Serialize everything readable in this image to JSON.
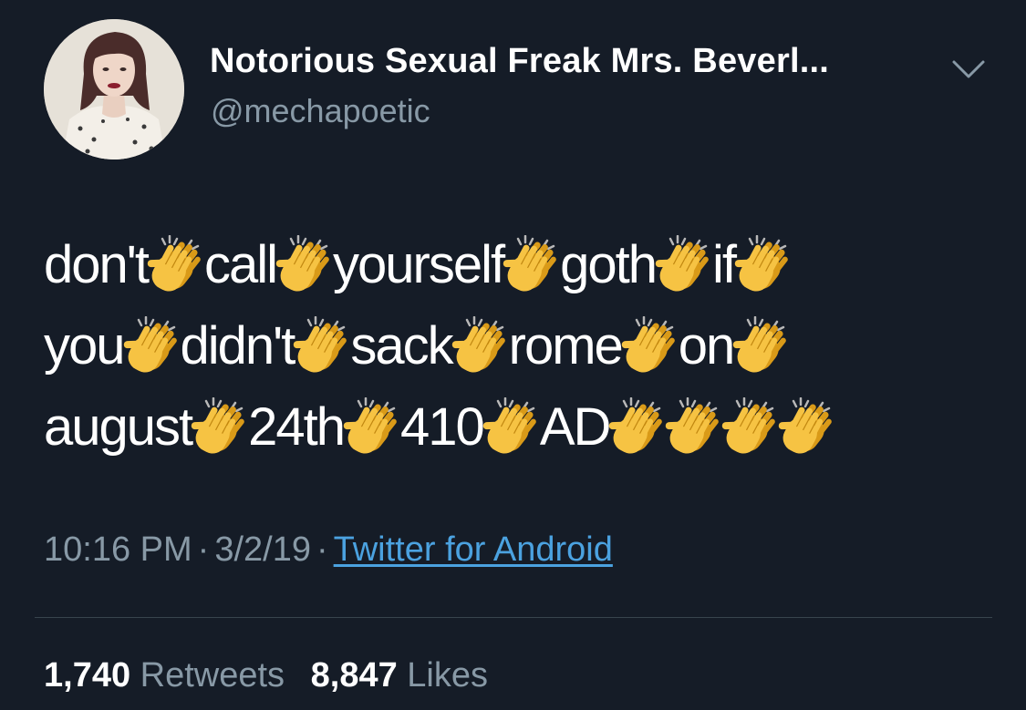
{
  "tweet": {
    "user": {
      "display_name": "Notorious Sexual Freak Mrs. Beverl...",
      "handle": "@mechapoetic",
      "avatar_icon": "profile-photo",
      "menu_icon": "chevron-down-icon"
    },
    "lines": [
      [
        "don't",
        "clap",
        "call",
        "clap",
        "yourself",
        "clap",
        "goth",
        "clap",
        "if",
        "clap"
      ],
      [
        "you",
        "clap",
        "didn't",
        "clap",
        "sack",
        "clap",
        "rome",
        "clap",
        "on",
        "clap"
      ],
      [
        "august",
        "clap",
        "24th",
        "clap",
        "410",
        "clap",
        "AD",
        "clap",
        "clap",
        "clap",
        "clap"
      ]
    ],
    "meta": {
      "time": "10:16 PM",
      "date": "3/2/19",
      "separator": "·",
      "source": "Twitter for Android"
    },
    "stats": {
      "retweets_count": "1,740",
      "retweets_label": "Retweets",
      "likes_count": "8,847",
      "likes_label": "Likes"
    }
  },
  "colors": {
    "background": "#151c27",
    "primary_text": "#ffffff",
    "secondary_text": "#8899a6",
    "link": "#4ba2e0",
    "divider": "#38444d",
    "clap_emoji": "#f6c343"
  }
}
